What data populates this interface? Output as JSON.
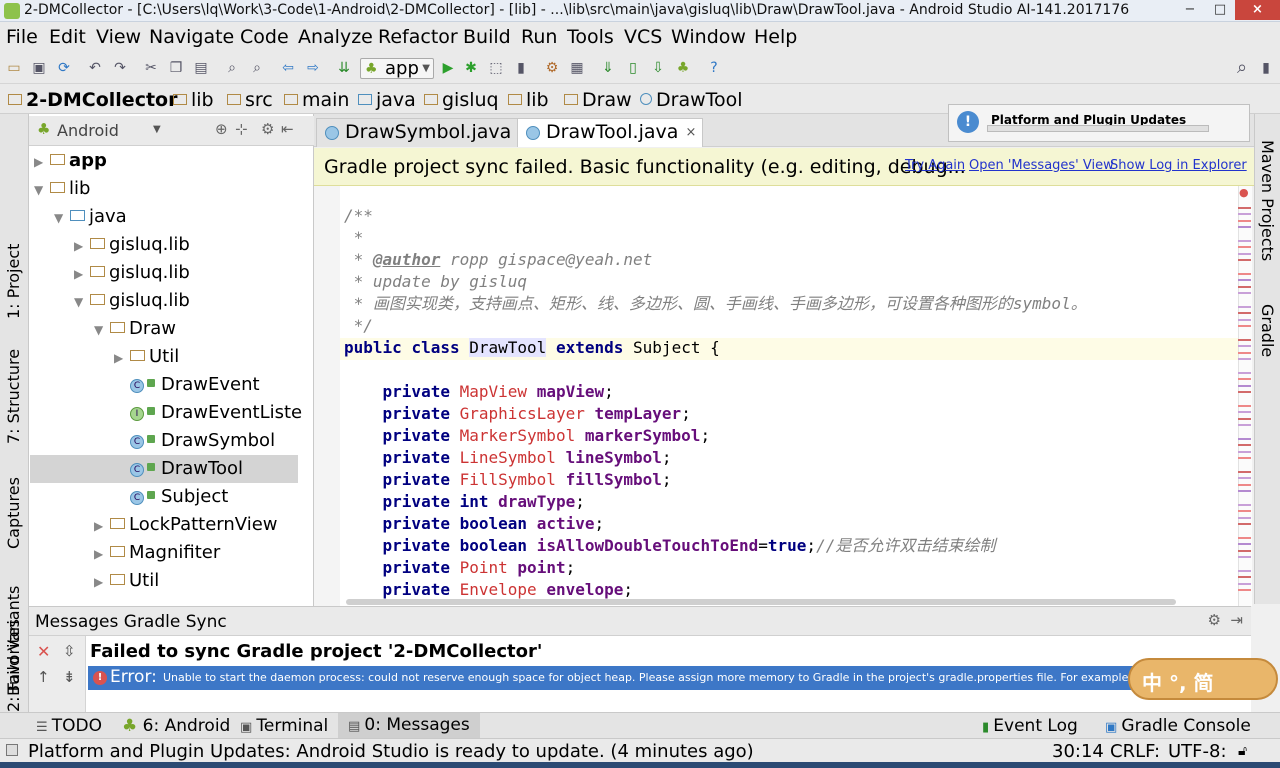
{
  "window": {
    "title": "2-DMCollector - [C:\\Users\\lq\\Work\\3-Code\\1-Android\\2-DMCollector] - [lib] - ...\\lib\\src\\main\\java\\gisluq\\lib\\Draw\\DrawTool.java - Android Studio AI-141.2017176",
    "minimize": "−",
    "maximize": "□",
    "close": "×"
  },
  "menu": [
    "File",
    "Edit",
    "View",
    "Navigate",
    "Code",
    "Analyze",
    "Refactor",
    "Build",
    "Run",
    "Tools",
    "VCS",
    "Window",
    "Help"
  ],
  "toolbar": {
    "run_config": "app",
    "icons": [
      "open-icon",
      "save-icon",
      "sync-icon",
      "undo-icon",
      "redo-icon",
      "cut-icon",
      "copy-icon",
      "paste-icon",
      "find-icon",
      "replace-icon",
      "back-icon",
      "forward-icon",
      "make-icon",
      "run-icon",
      "debug-icon",
      "attach-icon",
      "settings-icon",
      "project-structure-icon",
      "gradle-sync-icon",
      "avd-icon",
      "sdk-icon",
      "android-monitor-icon",
      "help-icon"
    ],
    "search": "⌕"
  },
  "breadcrumbs": [
    "2-DMCollector",
    "lib",
    "src",
    "main",
    "java",
    "gisluq",
    "lib",
    "Draw",
    "DrawTool"
  ],
  "notification": {
    "title": "Platform and Plugin Updates"
  },
  "project_panel": {
    "view": "Android",
    "tree": [
      {
        "label": "app",
        "kind": "module",
        "level": 0,
        "arrow": "▶"
      },
      {
        "label": "lib",
        "kind": "module",
        "level": 0,
        "arrow": "▼"
      },
      {
        "label": "java",
        "kind": "folder",
        "level": 1,
        "arrow": "▼"
      },
      {
        "label": "gisluq.lib",
        "kind": "package",
        "level": 2,
        "arrow": "▶"
      },
      {
        "label": "gisluq.lib",
        "kind": "package",
        "level": 2,
        "arrow": "▶"
      },
      {
        "label": "gisluq.lib",
        "kind": "package",
        "level": 2,
        "arrow": "▼"
      },
      {
        "label": "Draw",
        "kind": "package",
        "level": 3,
        "arrow": "▼"
      },
      {
        "label": "Util",
        "kind": "package",
        "level": 4,
        "arrow": "▶"
      },
      {
        "label": "DrawEvent",
        "kind": "class",
        "level": 4,
        "arrow": ""
      },
      {
        "label": "DrawEventListe",
        "kind": "interface",
        "level": 4,
        "arrow": ""
      },
      {
        "label": "DrawSymbol",
        "kind": "class",
        "level": 4,
        "arrow": ""
      },
      {
        "label": "DrawTool",
        "kind": "class",
        "level": 4,
        "arrow": "",
        "selected": true
      },
      {
        "label": "Subject",
        "kind": "class",
        "level": 4,
        "arrow": ""
      },
      {
        "label": "LockPatternView",
        "kind": "package",
        "level": 3,
        "arrow": "▶"
      },
      {
        "label": "Magnifiter",
        "kind": "package",
        "level": 3,
        "arrow": "▶"
      },
      {
        "label": "Util",
        "kind": "package",
        "level": 3,
        "arrow": "▶"
      }
    ]
  },
  "left_tool_tabs": [
    "1: Project",
    "7: Structure",
    "Captures",
    "Build Variants",
    "2: Favorites"
  ],
  "right_tool_tabs": [
    "Maven Projects",
    "Gradle"
  ],
  "editor": {
    "tabs": [
      {
        "label": "DrawSymbol.java",
        "close": "×",
        "active": false
      },
      {
        "label": "DrawTool.java",
        "close": "×",
        "active": true
      }
    ],
    "banner": {
      "message": "Gradle project sync failed. Basic functionality (e.g. editing, debug...",
      "links": [
        "Try Again",
        "Open 'Messages' View",
        "Show Log in Explorer"
      ]
    },
    "lines": [
      "/**",
      " *",
      " * @author ropp gispace@yeah.net",
      " * update by gisluq",
      " * 画图实现类，支持画点、矩形、线、多边形、圆、手画线、手画多边形，可设置各种图形的symbol。",
      " */",
      "public class DrawTool extends Subject {",
      "",
      "    private MapView mapView;",
      "    private GraphicsLayer tempLayer;",
      "    private MarkerSymbol markerSymbol;",
      "    private LineSymbol lineSymbol;",
      "    private FillSymbol fillSymbol;",
      "    private int drawType;",
      "    private boolean active;",
      "    private boolean isAllowDoubleTouchToEnd=true;//是否允许双击结束绘制",
      "    private Point point;",
      "    private Envelope envelope;"
    ]
  },
  "messages": {
    "header": "Messages Gradle Sync",
    "failure": "Failed to sync Gradle project '2-DMCollector'",
    "error_label": "Error:",
    "error_detail": "Unable to start the daemon process: could not reserve enough space for object heap. Please assign more memory to Gradle in the project's gradle.properties file. For example, the following"
  },
  "bottom_tabs": [
    "TODO",
    "6: Android",
    "Terminal",
    "0: Messages",
    "Event Log",
    "Gradle Console"
  ],
  "status": {
    "text": "Platform and Plugin Updates: Android Studio is ready to update. (4 minutes ago)",
    "position": "30:14",
    "line_sep": "CRLF:",
    "encoding": "UTF-8:"
  },
  "ime": {
    "text": "中 °, 简"
  },
  "colors": {
    "accent": "#3d77c7",
    "error": "#d9534f",
    "banner": "#f5f6d3",
    "run": "#2ca02c"
  }
}
